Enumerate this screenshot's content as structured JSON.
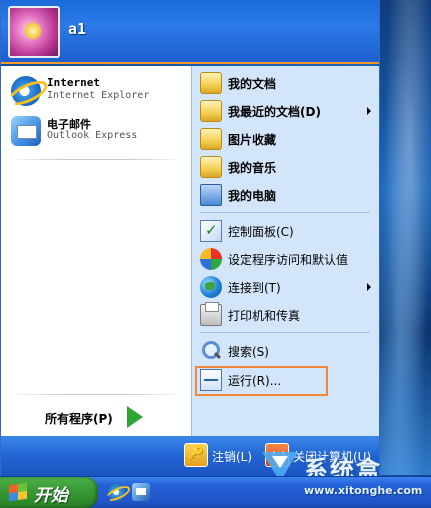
{
  "user": {
    "name": "a1"
  },
  "pinned": [
    {
      "title": "Internet",
      "subtitle": "Internet Explorer",
      "icon": "internet-explorer-icon"
    },
    {
      "title": "电子邮件",
      "subtitle": "Outlook Express",
      "icon": "outlook-express-icon"
    }
  ],
  "all_programs": {
    "label": "所有程序(P)"
  },
  "right_items": [
    {
      "label": "我的文档",
      "icon": "folder-icon",
      "submenu": false
    },
    {
      "label": "我最近的文档(D)",
      "icon": "folder-icon",
      "submenu": true
    },
    {
      "label": "图片收藏",
      "icon": "folder-icon",
      "submenu": false
    },
    {
      "label": "我的音乐",
      "icon": "folder-icon",
      "submenu": false
    },
    {
      "label": "我的电脑",
      "icon": "computer-icon",
      "submenu": false
    },
    {
      "label": "控制面板(C)",
      "icon": "control-panel-icon",
      "submenu": false
    },
    {
      "label": "设定程序访问和默认值",
      "icon": "default-programs-icon",
      "submenu": false
    },
    {
      "label": "连接到(T)",
      "icon": "globe-icon",
      "submenu": true
    },
    {
      "label": "打印机和传真",
      "icon": "printer-icon",
      "submenu": false
    },
    {
      "label": "搜索(S)",
      "icon": "search-icon",
      "submenu": false
    },
    {
      "label": "运行(R)...",
      "icon": "run-icon",
      "submenu": false
    }
  ],
  "footer": {
    "logoff_label": "注销(L)",
    "shutdown_label": "关闭计算机(U)"
  },
  "taskbar": {
    "start_label": "开始"
  },
  "watermark": {
    "title": "系统盒",
    "url": "www.xitonghe.com"
  },
  "colors": {
    "highlight": "#f2873a",
    "header_blue": "#2b7ae8",
    "start_green": "#3a9b36"
  }
}
